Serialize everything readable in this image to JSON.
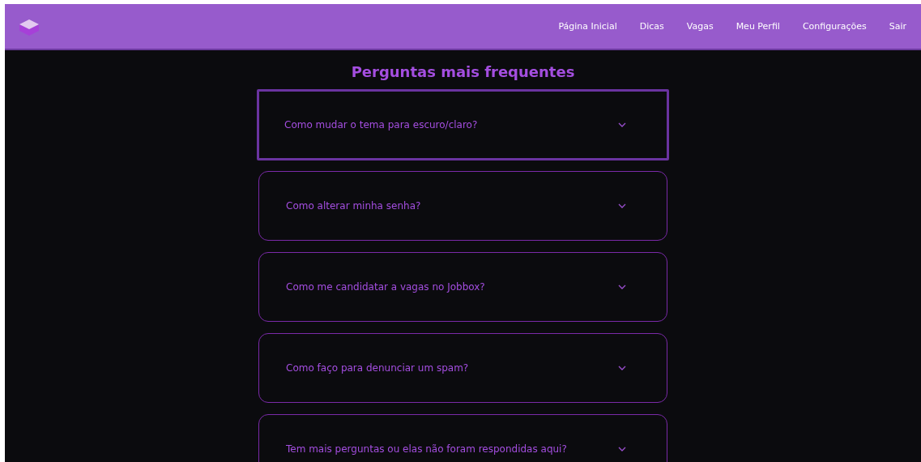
{
  "nav": {
    "links": [
      "Página Inicial",
      "Dicas",
      "Vagas",
      "Meu Perfil",
      "Configurações",
      "Sair"
    ]
  },
  "faq": {
    "title": "Perguntas mais frequentes",
    "items": [
      {
        "question": "Como mudar o tema para escuro/claro?",
        "focused": true
      },
      {
        "question": "Como alterar minha senha?",
        "focused": false
      },
      {
        "question": "Como me candidatar a vagas no Jobbox?",
        "focused": false
      },
      {
        "question": "Como faço para denunciar um spam?",
        "focused": false
      },
      {
        "question": "Tem mais perguntas ou elas não foram respondidas aqui?",
        "focused": false
      }
    ]
  }
}
